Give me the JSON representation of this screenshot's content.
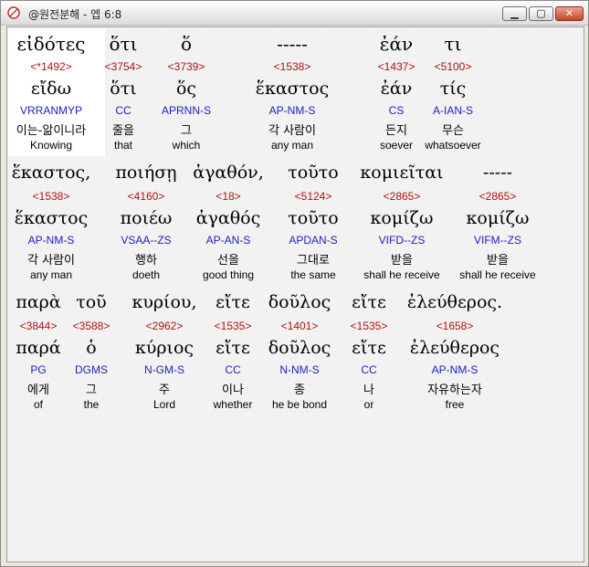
{
  "window": {
    "title": "@원전분해 - 엡 6:8",
    "minimize": "▁",
    "maximize": "▢",
    "close": "✕"
  },
  "rows": [
    {
      "words": [
        {
          "surface": "εἰδότες",
          "strong": "<*1492>",
          "lemma": "εἴδω",
          "morph": "VRRANMYP",
          "kor": "이는-앎이니라",
          "eng": "Knowing"
        },
        {
          "surface": "ὅτι",
          "strong": "<3754>",
          "lemma": "ὅτι",
          "morph": "CC",
          "kor": "줄을",
          "eng": "that"
        },
        {
          "surface": "ὅ",
          "strong": "<3739>",
          "lemma": "ὅς",
          "morph": "APRNN-S",
          "kor": "그",
          "eng": "which"
        },
        {
          "surface": "-----",
          "strong": "<1538>",
          "lemma": "ἕκαστος",
          "morph": "AP-NM-S",
          "kor": "각 사람이",
          "eng": "any man"
        },
        {
          "surface": "ἐάν",
          "strong": "<1437>",
          "lemma": "ἐάν",
          "morph": "CS",
          "kor": "든지",
          "eng": "soever"
        },
        {
          "surface": "τι",
          "strong": "<5100>",
          "lemma": "τίς",
          "morph": "A-IAN-S",
          "kor": "무슨",
          "eng": "whatsoever"
        }
      ]
    },
    {
      "words": [
        {
          "surface": "ἕκαστος,",
          "strong": "<1538>",
          "lemma": "ἕκαστος",
          "morph": "AP-NM-S",
          "kor": "각 사람이",
          "eng": "any man"
        },
        {
          "surface": "ποιήσῃ",
          "strong": "<4160>",
          "lemma": "ποιέω",
          "morph": "VSAA--ZS",
          "kor": "행하",
          "eng": "doeth"
        },
        {
          "surface": "ἀγαθόν,",
          "strong": "<18>",
          "lemma": "ἀγαθός",
          "morph": "AP-AN-S",
          "kor": "선을",
          "eng": "good thing"
        },
        {
          "surface": "τοῦτο",
          "strong": "<5124>",
          "lemma": "τοῦτο",
          "morph": "APDAN-S",
          "kor": "그대로",
          "eng": "the same"
        },
        {
          "surface": "κομιεῖται",
          "strong": "<2865>",
          "lemma": "κομίζω",
          "morph": "VIFD--ZS",
          "kor": "받을",
          "eng": "shall he receive"
        },
        {
          "surface": "-----",
          "strong": "<2865>",
          "lemma": "κομίζω",
          "morph": "VIFM--ZS",
          "kor": "받을",
          "eng": "shall he receive"
        }
      ]
    },
    {
      "words": [
        {
          "surface": "παρὰ",
          "strong": "<3844>",
          "lemma": "παρά",
          "morph": "PG",
          "kor": "에게",
          "eng": "of"
        },
        {
          "surface": "τοῦ",
          "strong": "<3588>",
          "lemma": "ὁ",
          "morph": "DGMS",
          "kor": "그",
          "eng": "the"
        },
        {
          "surface": "κυρίου,",
          "strong": "<2962>",
          "lemma": "κύριος",
          "morph": "N-GM-S",
          "kor": "주",
          "eng": "Lord"
        },
        {
          "surface": "εἴτε",
          "strong": "<1535>",
          "lemma": "εἴτε",
          "morph": "CC",
          "kor": "이나",
          "eng": "whether"
        },
        {
          "surface": "δοῦλος",
          "strong": "<1401>",
          "lemma": "δοῦλος",
          "morph": "N-NM-S",
          "kor": "종",
          "eng": "he be bond"
        },
        {
          "surface": "εἴτε",
          "strong": "<1535>",
          "lemma": "εἴτε",
          "morph": "CC",
          "kor": "나",
          "eng": "or"
        },
        {
          "surface": "ἐλεύθερος.",
          "strong": "<1658>",
          "lemma": "ἐλεύθερος",
          "morph": "AP-NM-S",
          "kor": "자유하는자",
          "eng": "free"
        }
      ]
    }
  ]
}
